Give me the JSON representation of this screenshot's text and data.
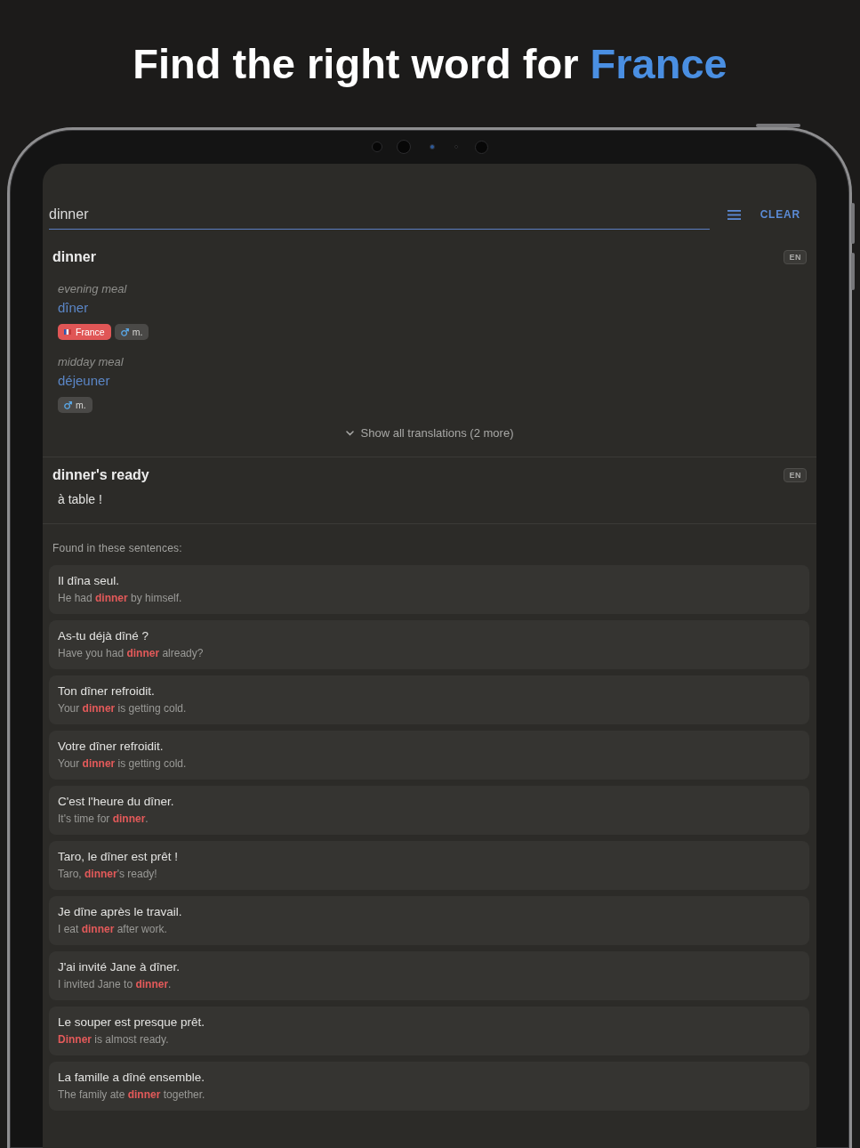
{
  "headline": {
    "text": "Find the right word for",
    "highlight": "France"
  },
  "search": {
    "value": "dinner",
    "clear_button": "CLEAR"
  },
  "entries": [
    {
      "kind": "senses",
      "headword": "dinner",
      "language": "EN",
      "senses": [
        {
          "gloss": "evening meal",
          "translation": "dîner",
          "tags": [
            {
              "kind": "region",
              "label": "France"
            },
            {
              "kind": "gender",
              "label": "m."
            }
          ]
        },
        {
          "gloss": "midday meal",
          "translation": "déjeuner",
          "tags": [
            {
              "kind": "gender",
              "label": "m."
            }
          ]
        }
      ],
      "more_link": "Show all translations (2 more)"
    },
    {
      "kind": "phrase",
      "headword": "dinner's ready",
      "language": "EN",
      "translation": "à table !"
    }
  ],
  "sentences": {
    "heading": "Found in these sentences:",
    "items": [
      {
        "french": "Il dîna seul.",
        "english": "He had **dinner** by himself."
      },
      {
        "french": "As-tu déjà dîné ?",
        "english": "Have you had **dinner** already?"
      },
      {
        "french": "Ton dîner refroidit.",
        "english": "Your **dinner** is getting cold."
      },
      {
        "french": "Votre dîner refroidit.",
        "english": "Your **dinner** is getting cold."
      },
      {
        "french": "C'est l'heure du dîner.",
        "english": "It's time for **dinner**."
      },
      {
        "french": "Taro, le dîner est prêt !",
        "english": "Taro, **dinner**'s ready!"
      },
      {
        "french": "Je dîne après le travail.",
        "english": "I eat **dinner** after work."
      },
      {
        "french": "J'ai invité Jane à dîner.",
        "english": "I invited Jane to **dinner**."
      },
      {
        "french": "Le souper est presque prêt.",
        "english": "**Dinner** is almost ready."
      },
      {
        "french": "La famille a dîné ensemble.",
        "english": "The family ate **dinner** together."
      }
    ]
  }
}
